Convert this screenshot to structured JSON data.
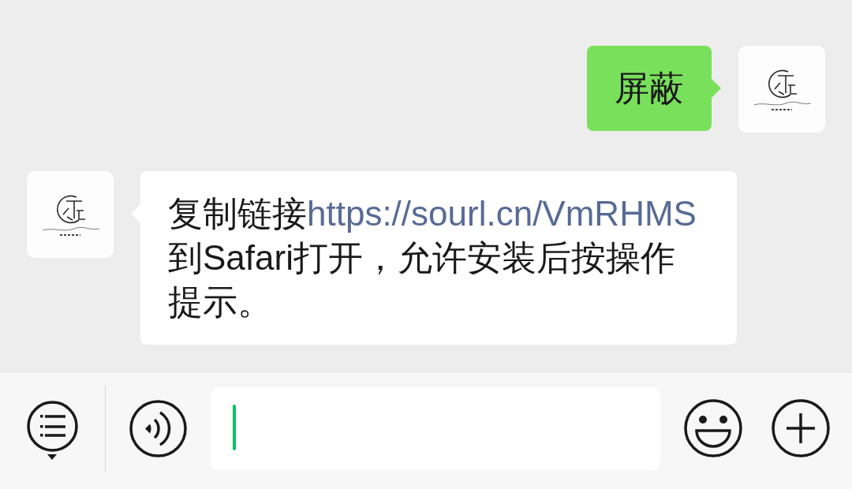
{
  "messages": [
    {
      "kind": "sent",
      "parts": [
        {
          "kind": "text",
          "text": "屏蔽"
        }
      ]
    },
    {
      "kind": "received",
      "parts": [
        {
          "kind": "text",
          "text": "复制链接"
        },
        {
          "kind": "link",
          "text": "https://sourl.cn/VmRHMS"
        },
        {
          "kind": "text",
          "text": "到Safari打开，允许安装后按操作提示。"
        }
      ]
    }
  ],
  "composer": {
    "focused": true
  }
}
